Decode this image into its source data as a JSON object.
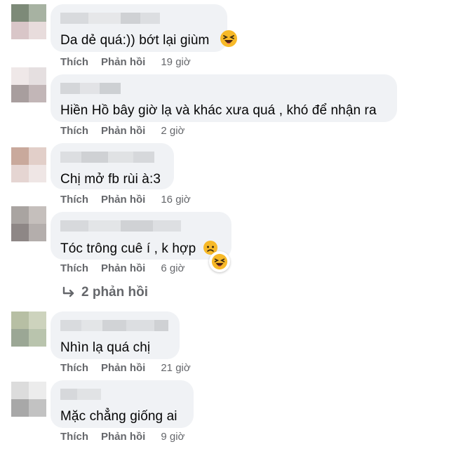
{
  "actions": {
    "like_label": "Thích",
    "reply_label": "Phản hồi"
  },
  "comments": [
    {
      "text": "Da dẻ quá:)) bớt lại giùm",
      "time": "19 giờ",
      "emoji": "laughing-face"
    },
    {
      "text": "Hiền Hồ bây giờ lạ và khác xưa quá , khó để nhận ra",
      "time": "2 giờ"
    },
    {
      "text": "Chị mở fb rùi à:3",
      "time": "16 giờ"
    },
    {
      "text": "Tóc trông cuê í , k hợp",
      "time": "6 giờ",
      "emoji": "sad-face",
      "reaction": "laughing-face"
    },
    {
      "text": "Nhìn lạ quá chị",
      "time": "21 giờ"
    },
    {
      "text": "Mặc chẳng giống ai",
      "time": "9 giờ"
    }
  ],
  "more_replies": {
    "label": "2 phản hồi",
    "icon": "reply-arrow-icon"
  },
  "colors": {
    "bubble": "#f0f2f5",
    "meta": "#65676b",
    "text": "#050505",
    "emoji": "#f7b928"
  }
}
